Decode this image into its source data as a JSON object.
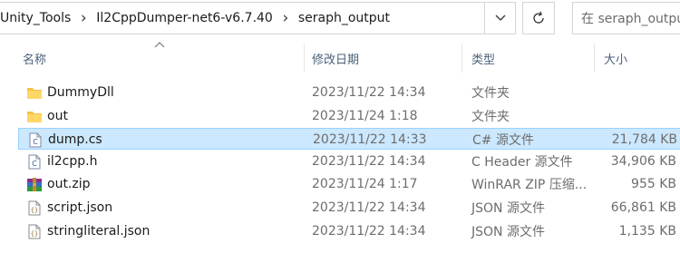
{
  "address_bar": {
    "crumbs": [
      "Unity_Tools",
      "Il2CppDumper-net6-v6.7.40",
      "seraph_output"
    ],
    "separator_icon": "chevron-right-icon",
    "dropdown_icon": "chevron-down-icon"
  },
  "refresh_icon": "refresh-icon",
  "search": {
    "placeholder": "在 seraph_output 中搜索"
  },
  "columns": {
    "name": "名称",
    "modified": "修改日期",
    "type": "类型",
    "size": "大小"
  },
  "colors": {
    "folder": "#f5c242",
    "selection_bg": "#cce8ff",
    "selection_border": "#99d1ff",
    "header_text": "#4c607a"
  },
  "files": [
    {
      "name": "DummyDll",
      "modified": "2023/11/22 14:34",
      "type": "文件夹",
      "size": "",
      "icon": "folder-icon",
      "selected": false
    },
    {
      "name": "out",
      "modified": "2023/11/24 1:18",
      "type": "文件夹",
      "size": "",
      "icon": "folder-icon",
      "selected": false
    },
    {
      "name": "dump.cs",
      "modified": "2023/11/22 14:33",
      "type": "C# 源文件",
      "size": "21,784 KB",
      "icon": "csharp-file-icon",
      "selected": true
    },
    {
      "name": "il2cpp.h",
      "modified": "2023/11/22 14:34",
      "type": "C Header 源文件",
      "size": "34,906 KB",
      "icon": "c-header-file-icon",
      "selected": false
    },
    {
      "name": "out.zip",
      "modified": "2023/11/24 1:17",
      "type": "WinRAR ZIP 压缩...",
      "size": "955 KB",
      "icon": "winrar-archive-icon",
      "selected": false
    },
    {
      "name": "script.json",
      "modified": "2023/11/22 14:34",
      "type": "JSON 源文件",
      "size": "66,861 KB",
      "icon": "json-file-icon",
      "selected": false
    },
    {
      "name": "stringliteral.json",
      "modified": "2023/11/22 14:34",
      "type": "JSON 源文件",
      "size": "1,135 KB",
      "icon": "json-file-icon",
      "selected": false
    }
  ]
}
